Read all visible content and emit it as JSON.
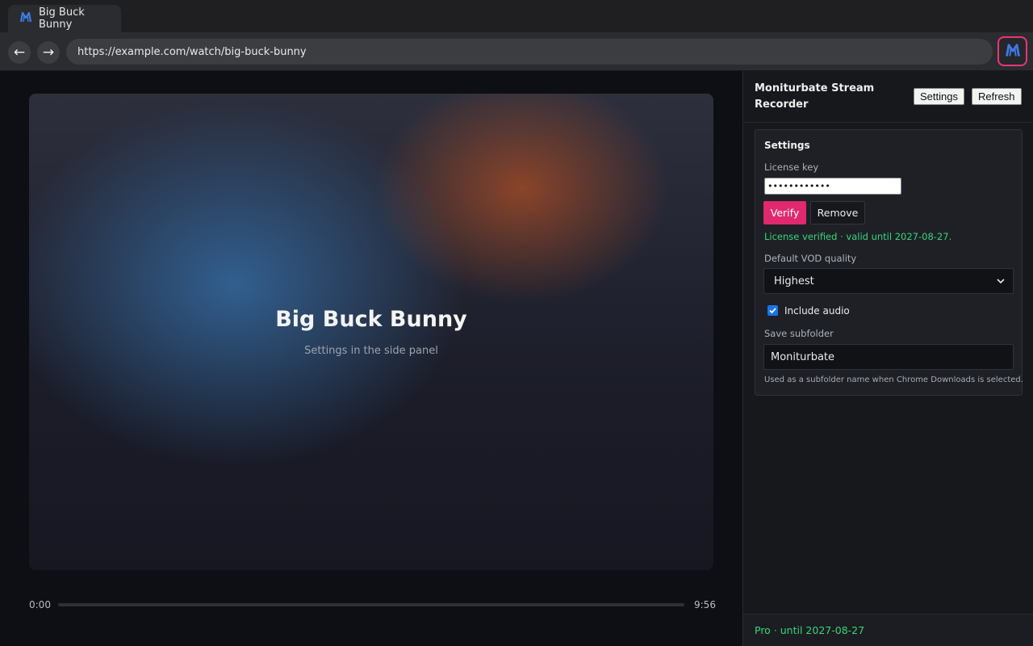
{
  "browser": {
    "tab": {
      "title": "Big Buck Bunny",
      "favicon_icon": "moniturbate-logo-icon"
    },
    "nav": {
      "back_symbol": "←",
      "forward_symbol": "→"
    },
    "url": "https://example.com/watch/big-buck-bunny",
    "extension_icon": "moniturbate-logo-icon",
    "accent_color": "#e8357b"
  },
  "player": {
    "title": "Big Buck Bunny",
    "subtitle": "Settings in the side panel",
    "time_current": "0:00",
    "time_total": "9:56",
    "progress_fraction": 0
  },
  "panel": {
    "title": "Moniturbate Stream Recorder",
    "settings_button": "Settings",
    "refresh_button": "Refresh",
    "settings_card": {
      "heading": "Settings",
      "license_label": "License key",
      "license_value": "••••••••••••",
      "verify_button": "Verify",
      "remove_button": "Remove",
      "license_status": "License verified · valid until 2027-08-27.",
      "quality_label": "Default VOD quality",
      "quality_value": "Highest",
      "include_audio_label": "Include audio",
      "include_audio_checked": true,
      "subfolder_label": "Save subfolder",
      "subfolder_value": "Moniturbate",
      "subfolder_help": "Used as a subfolder name when Chrome Downloads is selected."
    },
    "footer": "Pro · until 2027-08-27",
    "status_color": "#37d67a",
    "verify_color": "#e0296f"
  }
}
